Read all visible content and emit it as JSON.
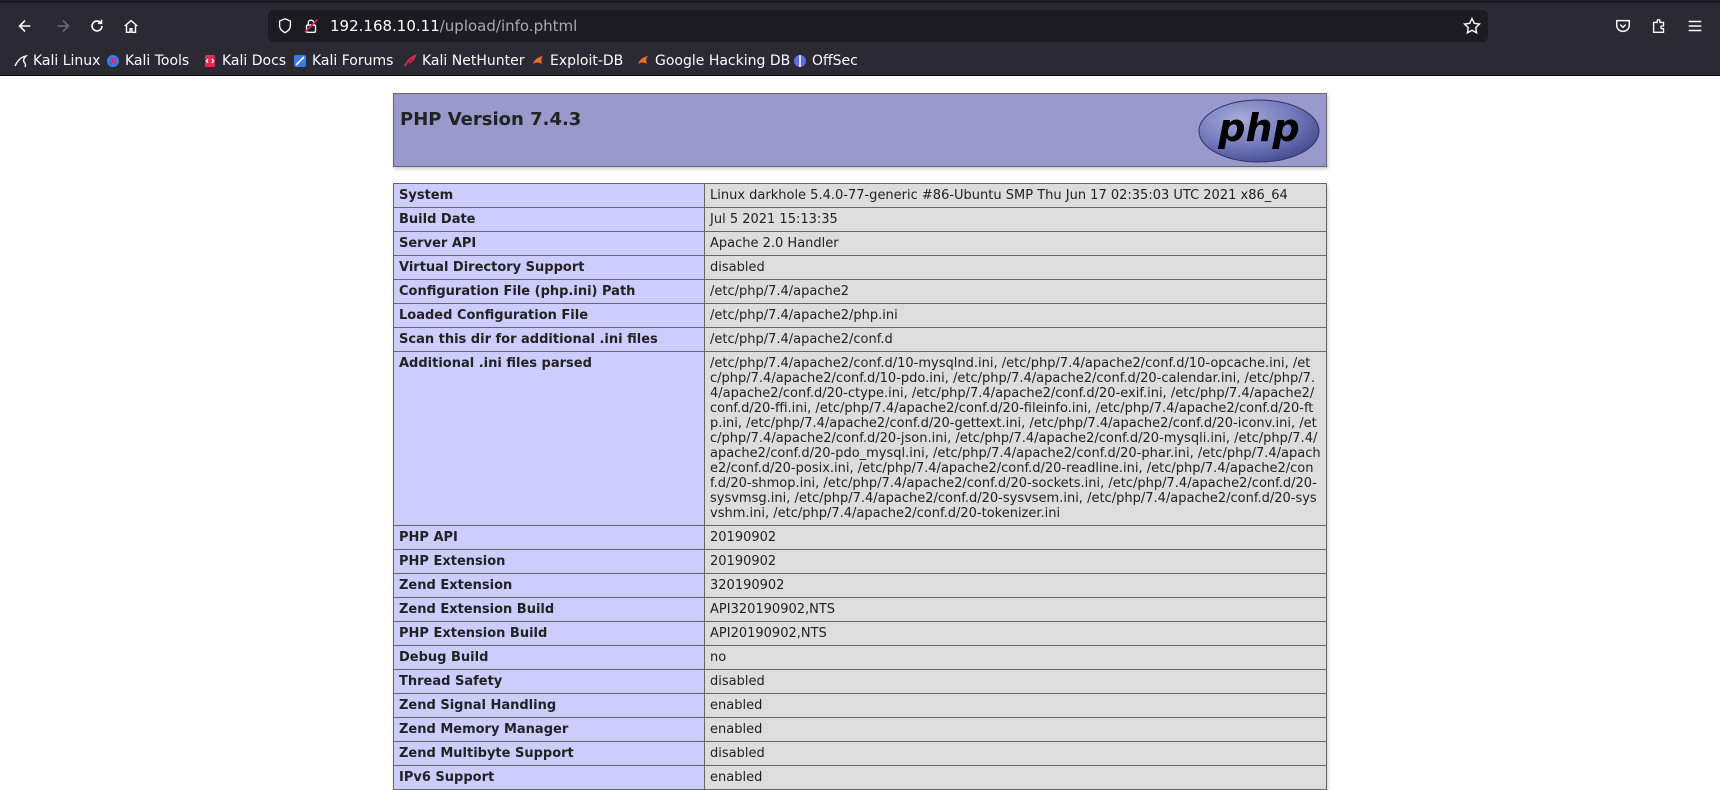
{
  "browser": {
    "url_host": "192.168.10.11",
    "url_path": "/upload/info.phtml",
    "bookmarks": [
      {
        "label": "Kali Linux",
        "icon": "kali-dragon-icon"
      },
      {
        "label": "Kali Tools",
        "icon": "kali-tools-icon"
      },
      {
        "label": "Kali Docs",
        "icon": "kali-docs-icon"
      },
      {
        "label": "Kali Forums",
        "icon": "kali-forums-icon"
      },
      {
        "label": "Kali NetHunter",
        "icon": "kali-nethunter-icon"
      },
      {
        "label": "Exploit-DB",
        "icon": "exploit-db-icon"
      },
      {
        "label": "Google Hacking DB",
        "icon": "ghdb-icon"
      },
      {
        "label": "OffSec",
        "icon": "offsec-icon"
      }
    ]
  },
  "php": {
    "title": "PHP Version 7.4.3",
    "logo_text": "php",
    "rows": [
      {
        "key": "System",
        "value": "Linux darkhole 5.4.0-77-generic #86-Ubuntu SMP Thu Jun 17 02:35:03 UTC 2021 x86_64"
      },
      {
        "key": "Build Date",
        "value": "Jul 5 2021 15:13:35"
      },
      {
        "key": "Server API",
        "value": "Apache 2.0 Handler"
      },
      {
        "key": "Virtual Directory Support",
        "value": "disabled"
      },
      {
        "key": "Configuration File (php.ini) Path",
        "value": "/etc/php/7.4/apache2"
      },
      {
        "key": "Loaded Configuration File",
        "value": "/etc/php/7.4/apache2/php.ini"
      },
      {
        "key": "Scan this dir for additional .ini files",
        "value": "/etc/php/7.4/apache2/conf.d"
      },
      {
        "key": "Additional .ini files parsed",
        "value": "/etc/php/7.4/apache2/conf.d/10-mysqlnd.ini, /etc/php/7.4/apache2/conf.d/10-opcache.ini, /etc/php/7.4/apache2/conf.d/10-pdo.ini, /etc/php/7.4/apache2/conf.d/20-calendar.ini, /etc/php/7.4/apache2/conf.d/20-ctype.ini, /etc/php/7.4/apache2/conf.d/20-exif.ini, /etc/php/7.4/apache2/conf.d/20-ffi.ini, /etc/php/7.4/apache2/conf.d/20-fileinfo.ini, /etc/php/7.4/apache2/conf.d/20-ftp.ini, /etc/php/7.4/apache2/conf.d/20-gettext.ini, /etc/php/7.4/apache2/conf.d/20-iconv.ini, /etc/php/7.4/apache2/conf.d/20-json.ini, /etc/php/7.4/apache2/conf.d/20-mysqli.ini, /etc/php/7.4/apache2/conf.d/20-pdo_mysql.ini, /etc/php/7.4/apache2/conf.d/20-phar.ini, /etc/php/7.4/apache2/conf.d/20-posix.ini, /etc/php/7.4/apache2/conf.d/20-readline.ini, /etc/php/7.4/apache2/conf.d/20-shmop.ini, /etc/php/7.4/apache2/conf.d/20-sockets.ini, /etc/php/7.4/apache2/conf.d/20-sysvmsg.ini, /etc/php/7.4/apache2/conf.d/20-sysvsem.ini, /etc/php/7.4/apache2/conf.d/20-sysvshm.ini, /etc/php/7.4/apache2/conf.d/20-tokenizer.ini"
      },
      {
        "key": "PHP API",
        "value": "20190902"
      },
      {
        "key": "PHP Extension",
        "value": "20190902"
      },
      {
        "key": "Zend Extension",
        "value": "320190902"
      },
      {
        "key": "Zend Extension Build",
        "value": "API320190902,NTS"
      },
      {
        "key": "PHP Extension Build",
        "value": "API20190902,NTS"
      },
      {
        "key": "Debug Build",
        "value": "no"
      },
      {
        "key": "Thread Safety",
        "value": "disabled"
      },
      {
        "key": "Zend Signal Handling",
        "value": "enabled"
      },
      {
        "key": "Zend Memory Manager",
        "value": "enabled"
      },
      {
        "key": "Zend Multibyte Support",
        "value": "disabled"
      },
      {
        "key": "IPv6 Support",
        "value": "enabled"
      }
    ]
  }
}
